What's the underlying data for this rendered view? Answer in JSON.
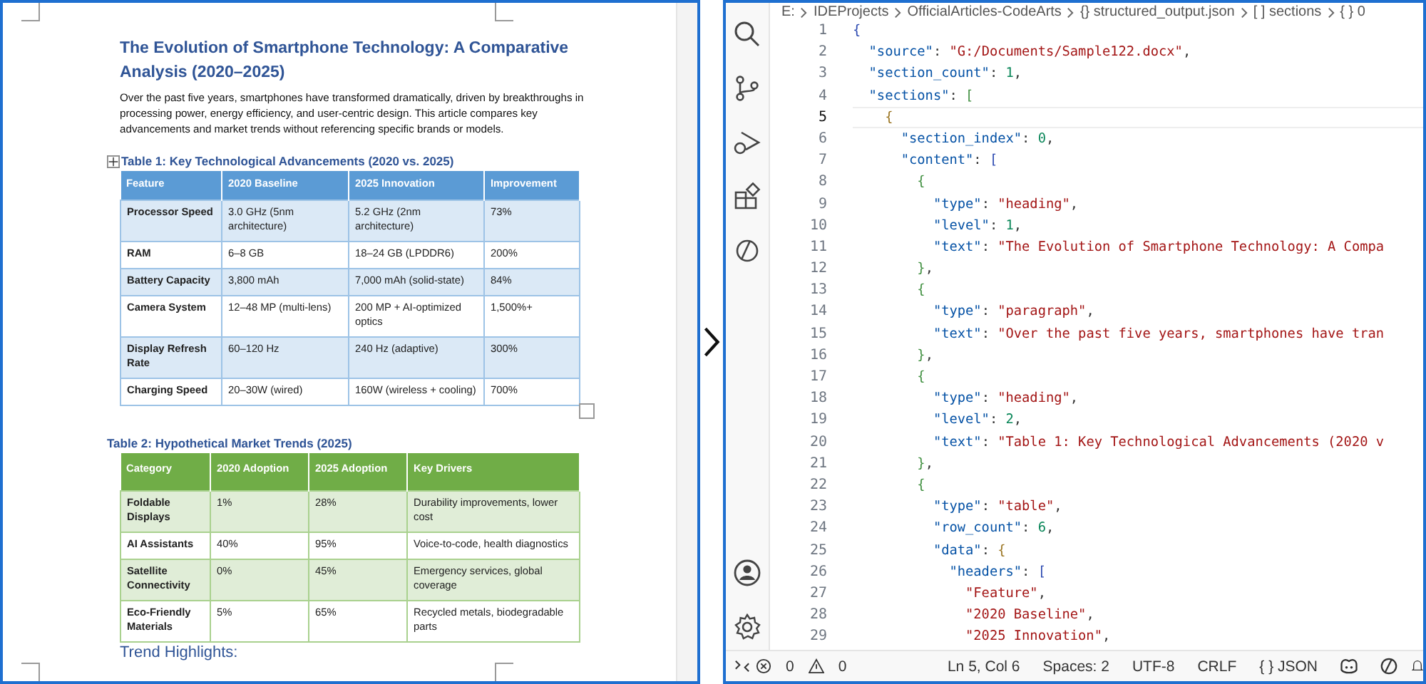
{
  "document": {
    "title": "The Evolution of Smartphone Technology: A Comparative Analysis (2020–2025)",
    "intro": "Over the past five years, smartphones have transformed dramatically, driven by breakthroughs in processing power, energy efficiency, and user-centric design. This article compares key advancements and market trends without referencing specific brands or models.",
    "tables": [
      {
        "caption": "Table 1: Key Technological Advancements (2020 vs. 2025)",
        "color": "#5b9bd5",
        "columns": [
          "Feature",
          "2020 Baseline",
          "2025 Innovation",
          "Improvement"
        ],
        "rows": [
          [
            "Processor Speed",
            "3.0 GHz (5nm architecture)",
            "5.2 GHz (2nm architecture)",
            "73%"
          ],
          [
            "RAM",
            "6–8 GB",
            "18–24 GB (LPDDR6)",
            "200%"
          ],
          [
            "Battery Capacity",
            "3,800 mAh",
            "7,000 mAh (solid-state)",
            "84%"
          ],
          [
            "Camera System",
            "12–48 MP (multi-lens)",
            "200 MP + AI-optimized optics",
            "1,500%+"
          ],
          [
            "Display Refresh Rate",
            "60–120 Hz",
            "240 Hz (adaptive)",
            "300%"
          ],
          [
            "Charging Speed",
            "20–30W (wired)",
            "160W (wireless + cooling)",
            "700%"
          ]
        ]
      },
      {
        "caption": "Table 2: Hypothetical Market Trends (2025)",
        "color": "#70ad47",
        "columns": [
          "Category",
          "2020 Adoption",
          "2025 Adoption",
          "Key Drivers"
        ],
        "rows": [
          [
            "Foldable Displays",
            "1%",
            "28%",
            "Durability improvements, lower cost"
          ],
          [
            "AI Assistants",
            "40%",
            "95%",
            "Voice-to-code, health diagnostics"
          ],
          [
            "Satellite Connectivity",
            "0%",
            "45%",
            "Emergency services, global coverage"
          ],
          [
            "Eco-Friendly Materials",
            "5%",
            "65%",
            "Recycled metals, biodegradable parts"
          ]
        ]
      }
    ],
    "subheading": "Trend Highlights:"
  },
  "editor": {
    "breadcrumbs": [
      "E:",
      "IDEProjects",
      "OfficialArticles-CodeArts",
      "{} structured_output.json",
      "[ ] sections",
      "{ } 0"
    ],
    "lines": [
      {
        "number": "1",
        "current": false,
        "tokens": [
          {
            "kind": "bracket1",
            "text": "{"
          }
        ]
      },
      {
        "number": "2",
        "current": false,
        "tokens": [
          {
            "kind": "key",
            "text": "  \"source\""
          },
          {
            "kind": "punct",
            "text": ": "
          },
          {
            "kind": "string",
            "text": "\"G:/Documents/Sample122.docx\""
          },
          {
            "kind": "punct",
            "text": ","
          }
        ]
      },
      {
        "number": "3",
        "current": false,
        "tokens": [
          {
            "kind": "key",
            "text": "  \"section_count\""
          },
          {
            "kind": "punct",
            "text": ": "
          },
          {
            "kind": "number",
            "text": "1"
          },
          {
            "kind": "punct",
            "text": ","
          }
        ]
      },
      {
        "number": "4",
        "current": false,
        "tokens": [
          {
            "kind": "key",
            "text": "  \"sections\""
          },
          {
            "kind": "punct",
            "text": ": "
          },
          {
            "kind": "bracket2",
            "text": "["
          }
        ]
      },
      {
        "number": "5",
        "current": true,
        "tokens": [
          {
            "kind": "bracket3",
            "text": "    {"
          }
        ]
      },
      {
        "number": "6",
        "current": false,
        "tokens": [
          {
            "kind": "key",
            "text": "      \"section_index\""
          },
          {
            "kind": "punct",
            "text": ": "
          },
          {
            "kind": "number",
            "text": "0"
          },
          {
            "kind": "punct",
            "text": ","
          }
        ]
      },
      {
        "number": "7",
        "current": false,
        "tokens": [
          {
            "kind": "key",
            "text": "      \"content\""
          },
          {
            "kind": "punct",
            "text": ": "
          },
          {
            "kind": "bracket1",
            "text": "["
          }
        ]
      },
      {
        "number": "8",
        "current": false,
        "tokens": [
          {
            "kind": "bracket2",
            "text": "        {"
          }
        ]
      },
      {
        "number": "9",
        "current": false,
        "tokens": [
          {
            "kind": "key",
            "text": "          \"type\""
          },
          {
            "kind": "punct",
            "text": ": "
          },
          {
            "kind": "string",
            "text": "\"heading\""
          },
          {
            "kind": "punct",
            "text": ","
          }
        ]
      },
      {
        "number": "10",
        "current": false,
        "tokens": [
          {
            "kind": "key",
            "text": "          \"level\""
          },
          {
            "kind": "punct",
            "text": ": "
          },
          {
            "kind": "number",
            "text": "1"
          },
          {
            "kind": "punct",
            "text": ","
          }
        ]
      },
      {
        "number": "11",
        "current": false,
        "tokens": [
          {
            "kind": "key",
            "text": "          \"text\""
          },
          {
            "kind": "punct",
            "text": ": "
          },
          {
            "kind": "string",
            "text": "\"The Evolution of Smartphone Technology: A Compa"
          }
        ]
      },
      {
        "number": "12",
        "current": false,
        "tokens": [
          {
            "kind": "bracket2",
            "text": "        }"
          },
          {
            "kind": "punct",
            "text": ","
          }
        ]
      },
      {
        "number": "13",
        "current": false,
        "tokens": [
          {
            "kind": "bracket2",
            "text": "        {"
          }
        ]
      },
      {
        "number": "14",
        "current": false,
        "tokens": [
          {
            "kind": "key",
            "text": "          \"type\""
          },
          {
            "kind": "punct",
            "text": ": "
          },
          {
            "kind": "string",
            "text": "\"paragraph\""
          },
          {
            "kind": "punct",
            "text": ","
          }
        ]
      },
      {
        "number": "15",
        "current": false,
        "tokens": [
          {
            "kind": "key",
            "text": "          \"text\""
          },
          {
            "kind": "punct",
            "text": ": "
          },
          {
            "kind": "string",
            "text": "\"Over the past five years, smartphones have tran"
          }
        ]
      },
      {
        "number": "16",
        "current": false,
        "tokens": [
          {
            "kind": "bracket2",
            "text": "        }"
          },
          {
            "kind": "punct",
            "text": ","
          }
        ]
      },
      {
        "number": "17",
        "current": false,
        "tokens": [
          {
            "kind": "bracket2",
            "text": "        {"
          }
        ]
      },
      {
        "number": "18",
        "current": false,
        "tokens": [
          {
            "kind": "key",
            "text": "          \"type\""
          },
          {
            "kind": "punct",
            "text": ": "
          },
          {
            "kind": "string",
            "text": "\"heading\""
          },
          {
            "kind": "punct",
            "text": ","
          }
        ]
      },
      {
        "number": "19",
        "current": false,
        "tokens": [
          {
            "kind": "key",
            "text": "          \"level\""
          },
          {
            "kind": "punct",
            "text": ": "
          },
          {
            "kind": "number",
            "text": "2"
          },
          {
            "kind": "punct",
            "text": ","
          }
        ]
      },
      {
        "number": "20",
        "current": false,
        "tokens": [
          {
            "kind": "key",
            "text": "          \"text\""
          },
          {
            "kind": "punct",
            "text": ": "
          },
          {
            "kind": "string",
            "text": "\"Table 1: Key Technological Advancements (2020 v"
          }
        ]
      },
      {
        "number": "21",
        "current": false,
        "tokens": [
          {
            "kind": "bracket2",
            "text": "        }"
          },
          {
            "kind": "punct",
            "text": ","
          }
        ]
      },
      {
        "number": "22",
        "current": false,
        "tokens": [
          {
            "kind": "bracket2",
            "text": "        {"
          }
        ]
      },
      {
        "number": "23",
        "current": false,
        "tokens": [
          {
            "kind": "key",
            "text": "          \"type\""
          },
          {
            "kind": "punct",
            "text": ": "
          },
          {
            "kind": "string",
            "text": "\"table\""
          },
          {
            "kind": "punct",
            "text": ","
          }
        ]
      },
      {
        "number": "24",
        "current": false,
        "tokens": [
          {
            "kind": "key",
            "text": "          \"row_count\""
          },
          {
            "kind": "punct",
            "text": ": "
          },
          {
            "kind": "number",
            "text": "6"
          },
          {
            "kind": "punct",
            "text": ","
          }
        ]
      },
      {
        "number": "25",
        "current": false,
        "tokens": [
          {
            "kind": "key",
            "text": "          \"data\""
          },
          {
            "kind": "punct",
            "text": ": "
          },
          {
            "kind": "bracket3",
            "text": "{"
          }
        ]
      },
      {
        "number": "26",
        "current": false,
        "tokens": [
          {
            "kind": "key",
            "text": "            \"headers\""
          },
          {
            "kind": "punct",
            "text": ": "
          },
          {
            "kind": "bracket1",
            "text": "["
          }
        ]
      },
      {
        "number": "27",
        "current": false,
        "tokens": [
          {
            "kind": "string",
            "text": "              \"Feature\""
          },
          {
            "kind": "punct",
            "text": ","
          }
        ]
      },
      {
        "number": "28",
        "current": false,
        "tokens": [
          {
            "kind": "string",
            "text": "              \"2020 Baseline\""
          },
          {
            "kind": "punct",
            "text": ","
          }
        ]
      },
      {
        "number": "29",
        "current": false,
        "tokens": [
          {
            "kind": "string",
            "text": "              \"2025 Innovation\""
          },
          {
            "kind": "punct",
            "text": ","
          }
        ]
      }
    ],
    "status_bar": {
      "errors": "0",
      "warnings": "0",
      "position": "Ln 5, Col 6",
      "indent": "Spaces: 2",
      "encoding": "UTF-8",
      "eol": "CRLF",
      "language": "{ } JSON"
    }
  }
}
